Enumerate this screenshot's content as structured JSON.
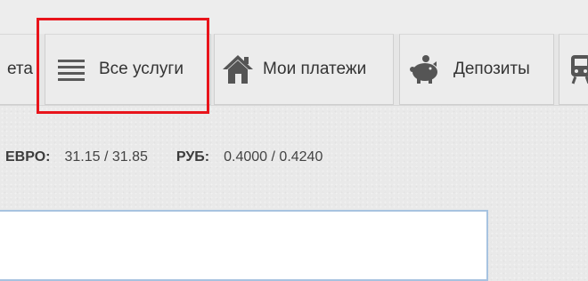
{
  "nav": {
    "items": [
      {
        "id": "accounts",
        "label": "ета",
        "icon": "none"
      },
      {
        "id": "services",
        "label": "Все услуги",
        "icon": "list-icon"
      },
      {
        "id": "payments",
        "label": "Мои платежи",
        "icon": "house-icon"
      },
      {
        "id": "deposits",
        "label": "Депозиты",
        "icon": "piggy-bank-icon"
      },
      {
        "id": "travel",
        "label": "",
        "icon": "train-icon"
      }
    ]
  },
  "annotation": {
    "color": "#e8141b"
  },
  "rates": {
    "eur": {
      "label": "ЕВРО:",
      "value": "31.15 / 31.85"
    },
    "rub": {
      "label": "РУБ:",
      "value": "0.4000 / 0.4240"
    }
  },
  "colors": {
    "panel_border": "#a7c3e0",
    "icon_gray": "#555555"
  }
}
